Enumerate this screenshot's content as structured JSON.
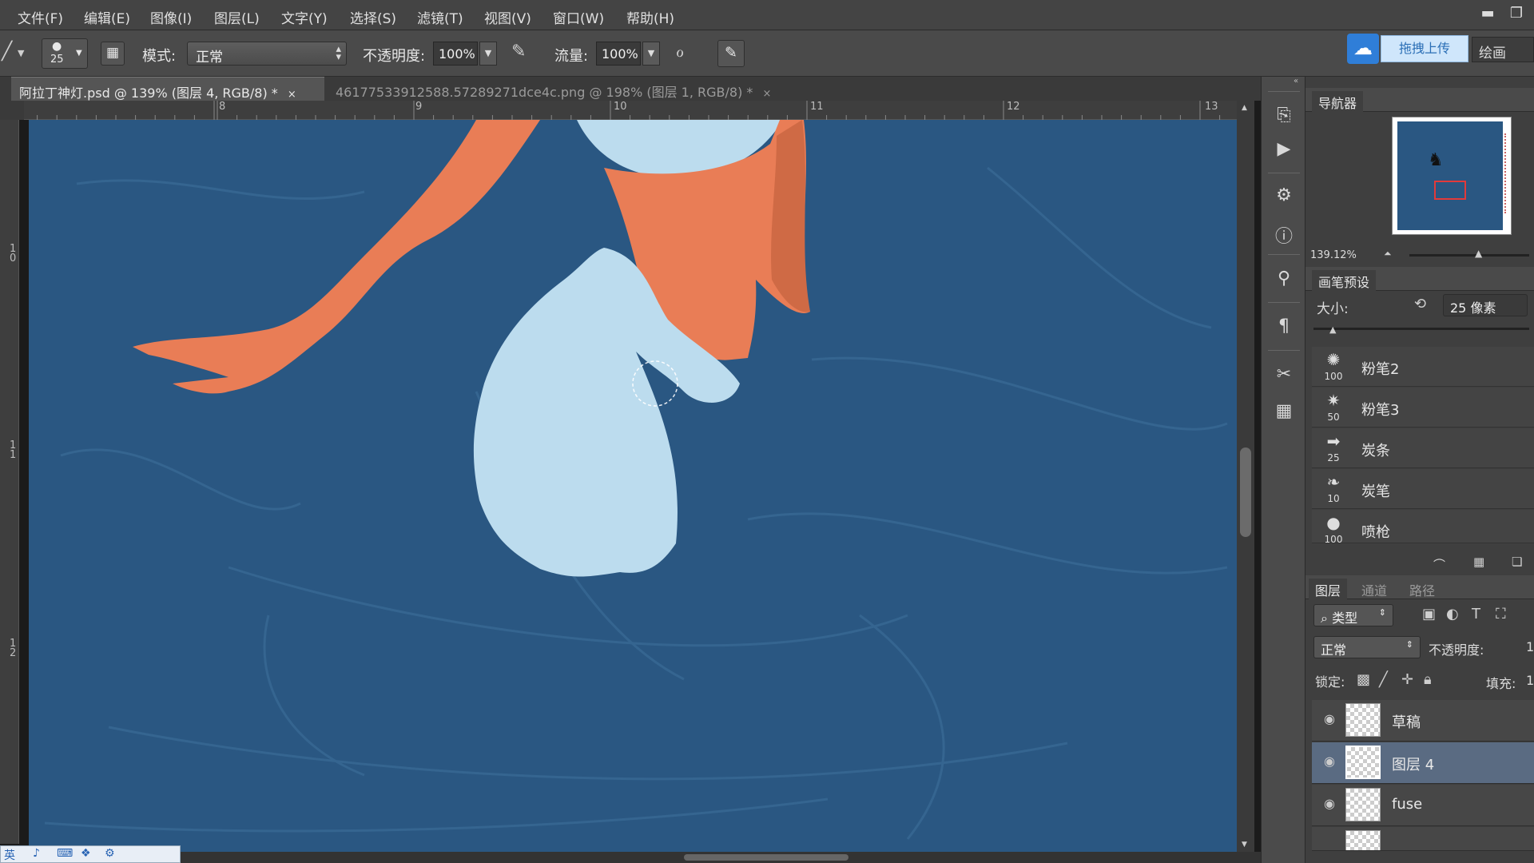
{
  "menu": [
    "文件(F)",
    "编辑(E)",
    "图像(I)",
    "图层(L)",
    "文字(Y)",
    "选择(S)",
    "滤镜(T)",
    "视图(V)",
    "窗口(W)",
    "帮助(H)"
  ],
  "options": {
    "brush_size": "25",
    "mode_label": "模式:",
    "mode_value": "正常",
    "opacity_label": "不透明度:",
    "opacity_value": "100%",
    "flow_label": "流量:",
    "flow_value": "100%"
  },
  "cloud": {
    "upload_label": "拖拽上传",
    "draw_label": "绘画"
  },
  "tabs": [
    {
      "label": "阿拉丁神灯.psd @ 139% (图层 4, RGB/8) *",
      "close": "×"
    },
    {
      "label": "46177533912588.57289271dce4c.png @ 198% (图层 1, RGB/8) *",
      "close": "×"
    }
  ],
  "ruler": {
    "top_ticks": [
      "8",
      "9",
      "10",
      "11",
      "12",
      "13"
    ],
    "left_ticks": [
      "1\n0",
      "1\n1",
      "1\n2"
    ]
  },
  "navigator": {
    "tab": "导航器",
    "zoom": "139.12%"
  },
  "brush_presets": {
    "tab": "画笔预设",
    "size_label": "大小:",
    "size_value": "25 像素",
    "items": [
      {
        "name": "粉笔2",
        "size": "100"
      },
      {
        "name": "粉笔3",
        "size": "50"
      },
      {
        "name": "炭条",
        "size": "25"
      },
      {
        "name": "炭笔",
        "size": "10"
      },
      {
        "name": "喷枪",
        "size": "100"
      }
    ]
  },
  "layers": {
    "tabs": [
      "图层",
      "通道",
      "路径"
    ],
    "filter_label": "类型",
    "blend_mode": "正常",
    "opacity_label": "不透明度:",
    "opacity_value": "1",
    "lock_label": "锁定:",
    "fill_label": "填充:",
    "fill_value": "1",
    "items": [
      {
        "name": "草稿",
        "selected": false
      },
      {
        "name": "图层 4",
        "selected": true
      },
      {
        "name": "fuse",
        "selected": false
      }
    ]
  },
  "colors": {
    "canvas": "#2a5782",
    "orange": "#e97d56",
    "light_blue": "#bcdcee",
    "selected_layer": "#5a6b82"
  }
}
